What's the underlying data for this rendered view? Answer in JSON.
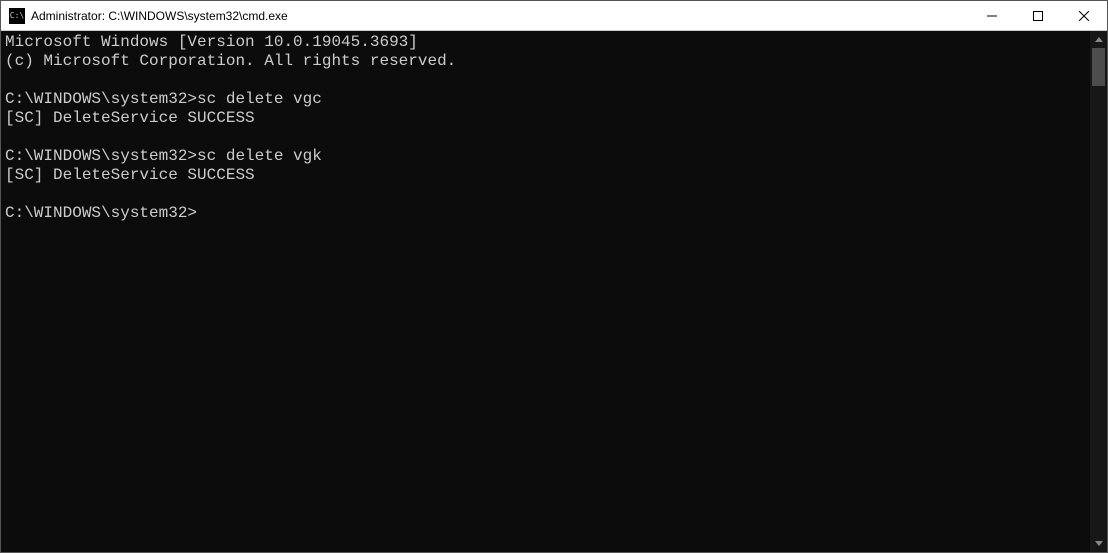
{
  "window": {
    "title": "Administrator: C:\\WINDOWS\\system32\\cmd.exe"
  },
  "terminal": {
    "lines": [
      "Microsoft Windows [Version 10.0.19045.3693]",
      "(c) Microsoft Corporation. All rights reserved.",
      "",
      "C:\\WINDOWS\\system32>sc delete vgc",
      "[SC] DeleteService SUCCESS",
      "",
      "C:\\WINDOWS\\system32>sc delete vgk",
      "[SC] DeleteService SUCCESS",
      "",
      "C:\\WINDOWS\\system32>"
    ]
  }
}
